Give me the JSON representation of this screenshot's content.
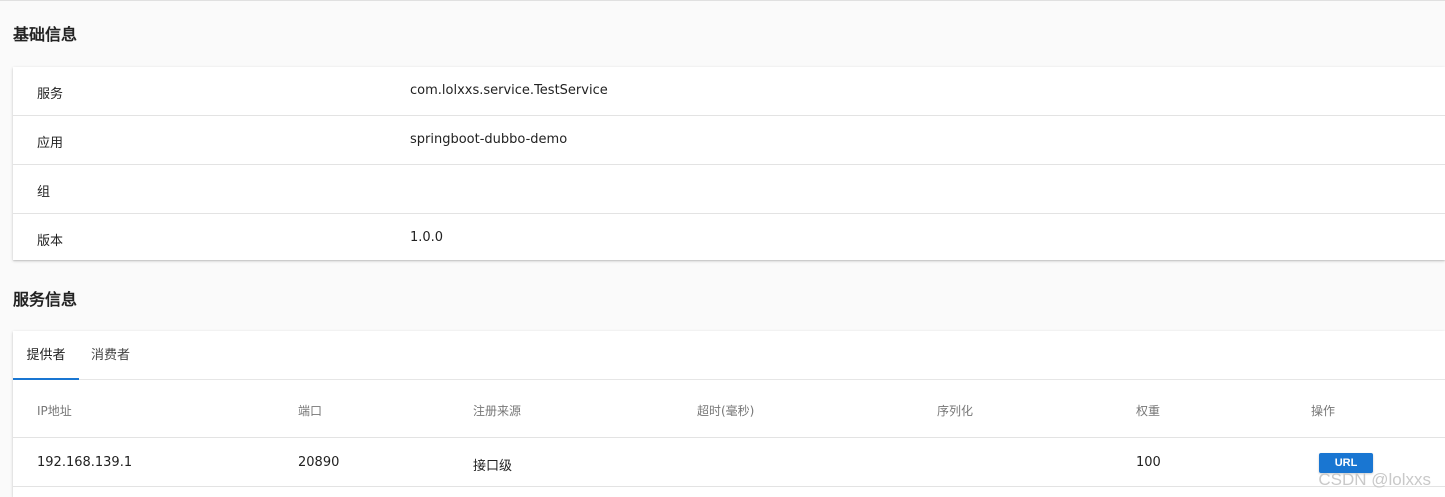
{
  "basic_info": {
    "title": "基础信息",
    "rows": [
      {
        "key": "服务",
        "value": "com.lolxxs.service.TestService"
      },
      {
        "key": "应用",
        "value": "springboot-dubbo-demo"
      },
      {
        "key": "组",
        "value": ""
      },
      {
        "key": "版本",
        "value": "1.0.0"
      }
    ]
  },
  "service_info": {
    "title": "服务信息",
    "tabs": [
      {
        "label": "提供者",
        "active": true
      },
      {
        "label": "消费者",
        "active": false
      }
    ],
    "columns": [
      "IP地址",
      "端口",
      "注册来源",
      "超时(毫秒)",
      "序列化",
      "权重",
      "操作"
    ],
    "rows": [
      {
        "ip": "192.168.139.1",
        "port": "20890",
        "source": "接口级",
        "timeout": "",
        "serialization": "",
        "weight": "100",
        "action": "URL"
      }
    ]
  },
  "accent_color": "#1976d2",
  "watermark": "CSDN @lolxxs"
}
